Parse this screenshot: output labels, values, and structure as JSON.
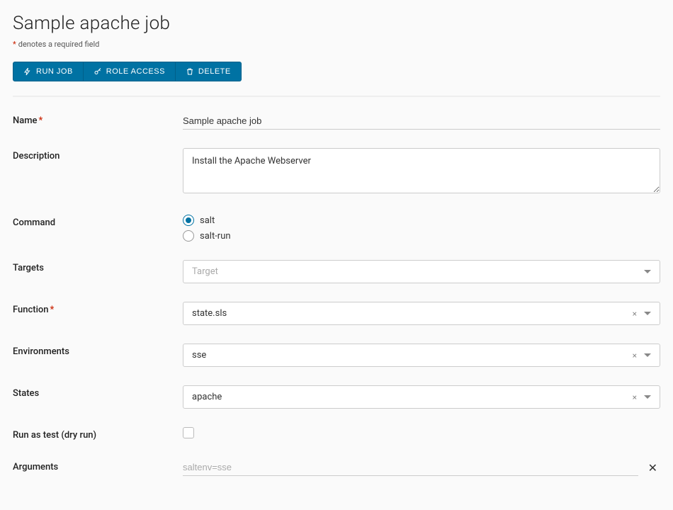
{
  "page": {
    "title": "Sample apache job",
    "required_note": "denotes a required field"
  },
  "toolbar": {
    "run_label": "RUN JOB",
    "role_access_label": "ROLE ACCESS",
    "delete_label": "DELETE"
  },
  "form": {
    "name": {
      "label": "Name",
      "value": "Sample apache job"
    },
    "description": {
      "label": "Description",
      "value": "Install the Apache Webserver"
    },
    "command": {
      "label": "Command",
      "options": [
        {
          "value": "salt",
          "label": "salt",
          "checked": true
        },
        {
          "value": "salt-run",
          "label": "salt-run",
          "checked": false
        }
      ]
    },
    "targets": {
      "label": "Targets",
      "placeholder": "Target",
      "value": ""
    },
    "function": {
      "label": "Function",
      "value": "state.sls"
    },
    "environments": {
      "label": "Environments",
      "value": "sse"
    },
    "states": {
      "label": "States",
      "value": "apache"
    },
    "run_as_test": {
      "label": "Run as test (dry run)",
      "checked": false
    },
    "arguments": {
      "label": "Arguments",
      "items": [
        {
          "value": "saltenv=sse"
        }
      ]
    }
  }
}
